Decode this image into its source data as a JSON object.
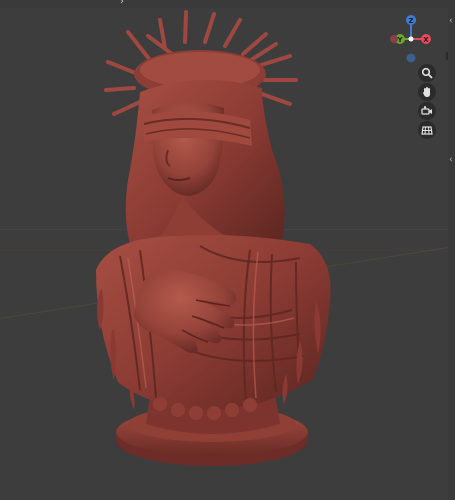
{
  "header": {
    "collapse_chevron": "›",
    "editor_mode_icon": "blender-mode-icon"
  },
  "gizmo": {
    "axes": {
      "x": {
        "label": "X",
        "color": "#e54a5a"
      },
      "y": {
        "label": "Y",
        "color": "#6aa72e"
      },
      "z": {
        "label": "Z",
        "color": "#3d7fd6"
      }
    },
    "neg_axes_colors": {
      "x": "#8a3f46",
      "y": "#4c6f2a",
      "z": "#3b5f8f"
    },
    "center_dot": "#ffffff"
  },
  "navigation": {
    "buttons": [
      {
        "name": "zoom-view-icon"
      },
      {
        "name": "pan-view-hand-icon"
      },
      {
        "name": "toggle-camera-icon"
      },
      {
        "name": "toggle-ortho-grid-icon"
      }
    ]
  },
  "sidebar": {
    "chevrons": [
      "‹",
      "‹"
    ]
  },
  "viewport": {
    "background": "#3d3d3d",
    "model_color": "#9a4238",
    "model_highlight": "#c4685a",
    "model_shadow": "#5a2320",
    "x_axis_line_color": "#7a3a3c",
    "y_axis_line_color": "#4f6233"
  }
}
